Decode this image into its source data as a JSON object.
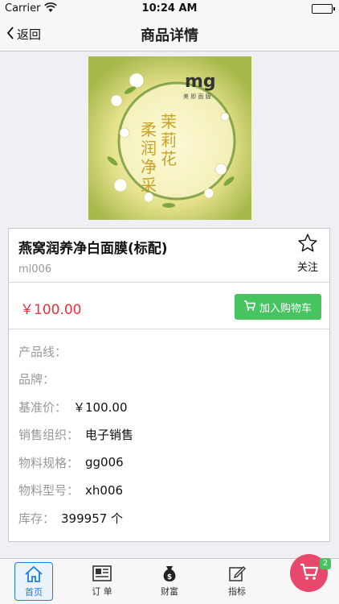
{
  "status_bar": {
    "carrier": "Carrier",
    "time": "10:24 AM"
  },
  "nav": {
    "back_label": "返回",
    "title": "商品详情"
  },
  "product": {
    "image_icon": "product-package-image",
    "name": "燕窝润养净白面膜(标配)",
    "code": "ml006",
    "follow_label": "关注",
    "price": "￥100.00",
    "add_to_cart_label": "加入购物车"
  },
  "attributes": [
    {
      "label": "产品线：",
      "value": ""
    },
    {
      "label": "品牌：",
      "value": ""
    },
    {
      "label": "基准价：",
      "value": "￥100.00"
    },
    {
      "label": "销售组织：",
      "value": "电子销售"
    },
    {
      "label": "物料规格：",
      "value": "gg006"
    },
    {
      "label": "物料型号：",
      "value": "xh006"
    },
    {
      "label": "库存：",
      "value": "399957 个"
    }
  ],
  "tab_bar": {
    "tabs": [
      {
        "label": "首页",
        "icon": "home-icon"
      },
      {
        "label": "订 单",
        "icon": "order-icon"
      },
      {
        "label": "财富",
        "icon": "money-bag-icon"
      },
      {
        "label": "指标",
        "icon": "edit-icon"
      }
    ],
    "cart_badge": "2"
  },
  "colors": {
    "price": "#e8303c",
    "cart_button": "#45c460",
    "fab": "#e8486c",
    "active_tab": "#1e7be0"
  }
}
